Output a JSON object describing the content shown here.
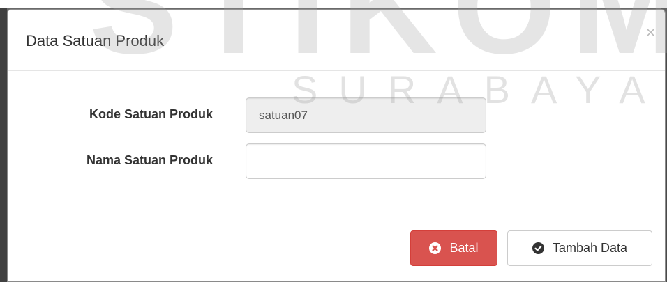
{
  "modal": {
    "title": "Data Satuan Produk",
    "close_symbol": "×",
    "close_icon": "close-icon"
  },
  "form": {
    "kode_label": "Kode Satuan Produk",
    "kode_value": "satuan07",
    "nama_label": "Nama Satuan Produk",
    "nama_value": "",
    "nama_placeholder": ""
  },
  "footer": {
    "cancel_label": "Batal",
    "cancel_icon": "times-circle-icon",
    "submit_label": "Tambah Data",
    "submit_icon": "check-circle-icon"
  },
  "watermark": {
    "large": "STIKOM",
    "small": "SURABAYA"
  },
  "colors": {
    "danger": "#d9534f",
    "readonly_bg": "#eeeeee",
    "text": "#333333"
  }
}
